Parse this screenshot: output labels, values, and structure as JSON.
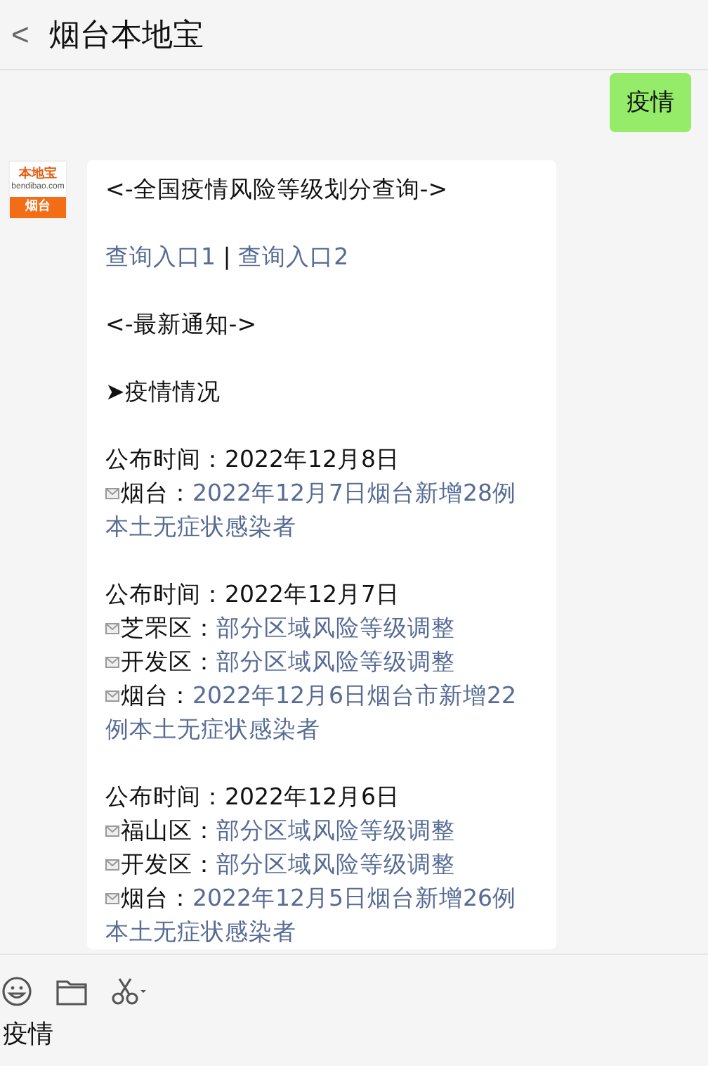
{
  "header": {
    "back": "<",
    "title": "烟台本地宝"
  },
  "messages": [
    {
      "kind": "outgoing",
      "text": "疫情"
    },
    {
      "kind": "incoming",
      "avatar": {
        "logo": "本地宝",
        "site": "bendibao.com",
        "city": "烟台"
      },
      "lines": [
        {
          "kind": "text",
          "text": "<-全国疫情风险等级划分查询->"
        },
        {
          "kind": "blank"
        },
        {
          "kind": "links",
          "links": [
            "查询入口1",
            "查询入口2"
          ],
          "separator": "|"
        },
        {
          "kind": "blank"
        },
        {
          "kind": "text",
          "text": "<-最新通知->"
        },
        {
          "kind": "blank"
        },
        {
          "kind": "text",
          "text": "➤疫情情况"
        },
        {
          "kind": "blank"
        },
        {
          "kind": "text",
          "text": "公布时间：2022年12月8日"
        },
        {
          "kind": "item",
          "label": "烟台：",
          "link": [
            "2022年12月7日烟台新增28例",
            "本土无症状感染者"
          ]
        },
        {
          "kind": "blank"
        },
        {
          "kind": "text",
          "text": "公布时间：2022年12月7日"
        },
        {
          "kind": "item",
          "label": "芝罘区：",
          "link": [
            "部分区域风险等级调整"
          ]
        },
        {
          "kind": "item",
          "label": "开发区：",
          "link": [
            "部分区域风险等级调整"
          ]
        },
        {
          "kind": "item",
          "label": "烟台：",
          "link": [
            "2022年12月6日烟台市新增22",
            "例本土无症状感染者"
          ]
        },
        {
          "kind": "blank"
        },
        {
          "kind": "text",
          "text": "公布时间：2022年12月6日"
        },
        {
          "kind": "item",
          "label": "福山区：",
          "link": [
            "部分区域风险等级调整"
          ]
        },
        {
          "kind": "item",
          "label": "开发区：",
          "link": [
            "部分区域风险等级调整"
          ]
        },
        {
          "kind": "item",
          "label": "烟台：",
          "link": [
            "2022年12月5日烟台新增26例",
            "本土无症状感染者"
          ]
        }
      ]
    }
  ],
  "composer": {
    "value": "疫情"
  }
}
